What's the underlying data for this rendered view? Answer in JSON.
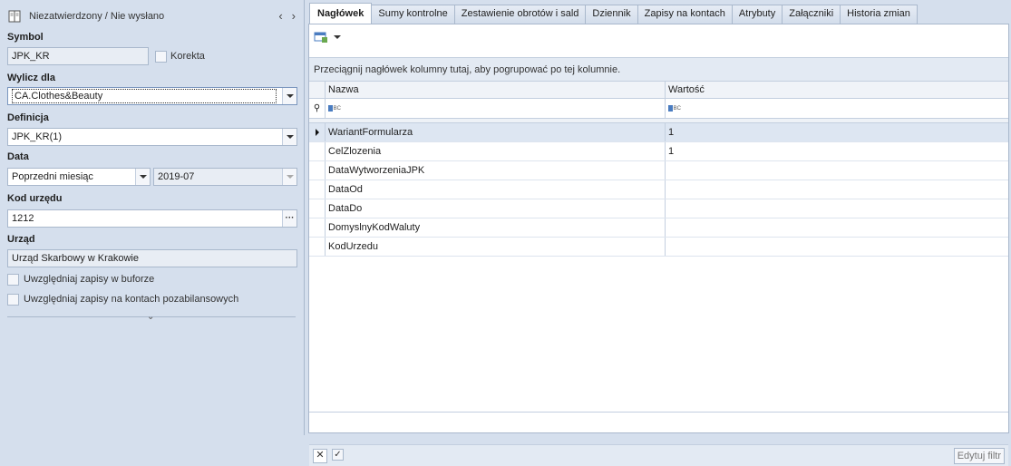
{
  "header": {
    "status": "Niezatwierdzony / Nie wysłano",
    "prev_icon": "‹",
    "next_icon": "›"
  },
  "form": {
    "symbol_label": "Symbol",
    "symbol_value": "JPK_KR",
    "korekta_label": "Korekta",
    "wylicz_label": "Wylicz dla",
    "wylicz_value": "CA.Clothes&Beauty",
    "definicja_label": "Definicja",
    "definicja_value": "JPK_KR(1)",
    "data_label": "Data",
    "data_period": "Poprzedni miesiąc",
    "data_value": "2019-07",
    "kod_label": "Kod urzędu",
    "kod_value": "1212",
    "kod_button": "···",
    "urzad_label": "Urząd",
    "urzad_value": "Urząd Skarbowy w Krakowie",
    "chk_bufor": "Uwzględniaj zapisy w buforze",
    "chk_pozabilans": "Uwzględniaj zapisy na kontach pozabilansowych",
    "collapse_glyph": "⌄"
  },
  "tabs": [
    {
      "label": "Nagłówek"
    },
    {
      "label": "Sumy kontrolne"
    },
    {
      "label": "Zestawienie obrotów i sald"
    },
    {
      "label": "Dziennik"
    },
    {
      "label": "Zapisy na kontach"
    },
    {
      "label": "Atrybuty"
    },
    {
      "label": "Załączniki"
    },
    {
      "label": "Historia zmian"
    }
  ],
  "grid": {
    "group_hint": "Przeciągnij nagłówek kolumny tutaj, aby pogrupować po tej kolumnie.",
    "col_name": "Nazwa",
    "col_value": "Wartość",
    "filter_icon": "⚲",
    "rows": [
      {
        "name": "WariantFormularza",
        "value": "1"
      },
      {
        "name": "CelZlozenia",
        "value": "1"
      },
      {
        "name": "DataWytworzeniaJPK",
        "value": ""
      },
      {
        "name": "DataOd",
        "value": ""
      },
      {
        "name": "DataDo",
        "value": ""
      },
      {
        "name": "DomyslnyKodWaluty",
        "value": ""
      },
      {
        "name": "KodUrzedu",
        "value": ""
      }
    ]
  },
  "footer": {
    "close_glyph": "✕",
    "check_glyph": "✓",
    "edit_filter": "Edytuj filtr"
  },
  "colors": {
    "panel_bg": "#d5dfed",
    "border": "#a9b8cc",
    "accent": "#4a7cc0",
    "selected_row": "#dde6f2"
  }
}
